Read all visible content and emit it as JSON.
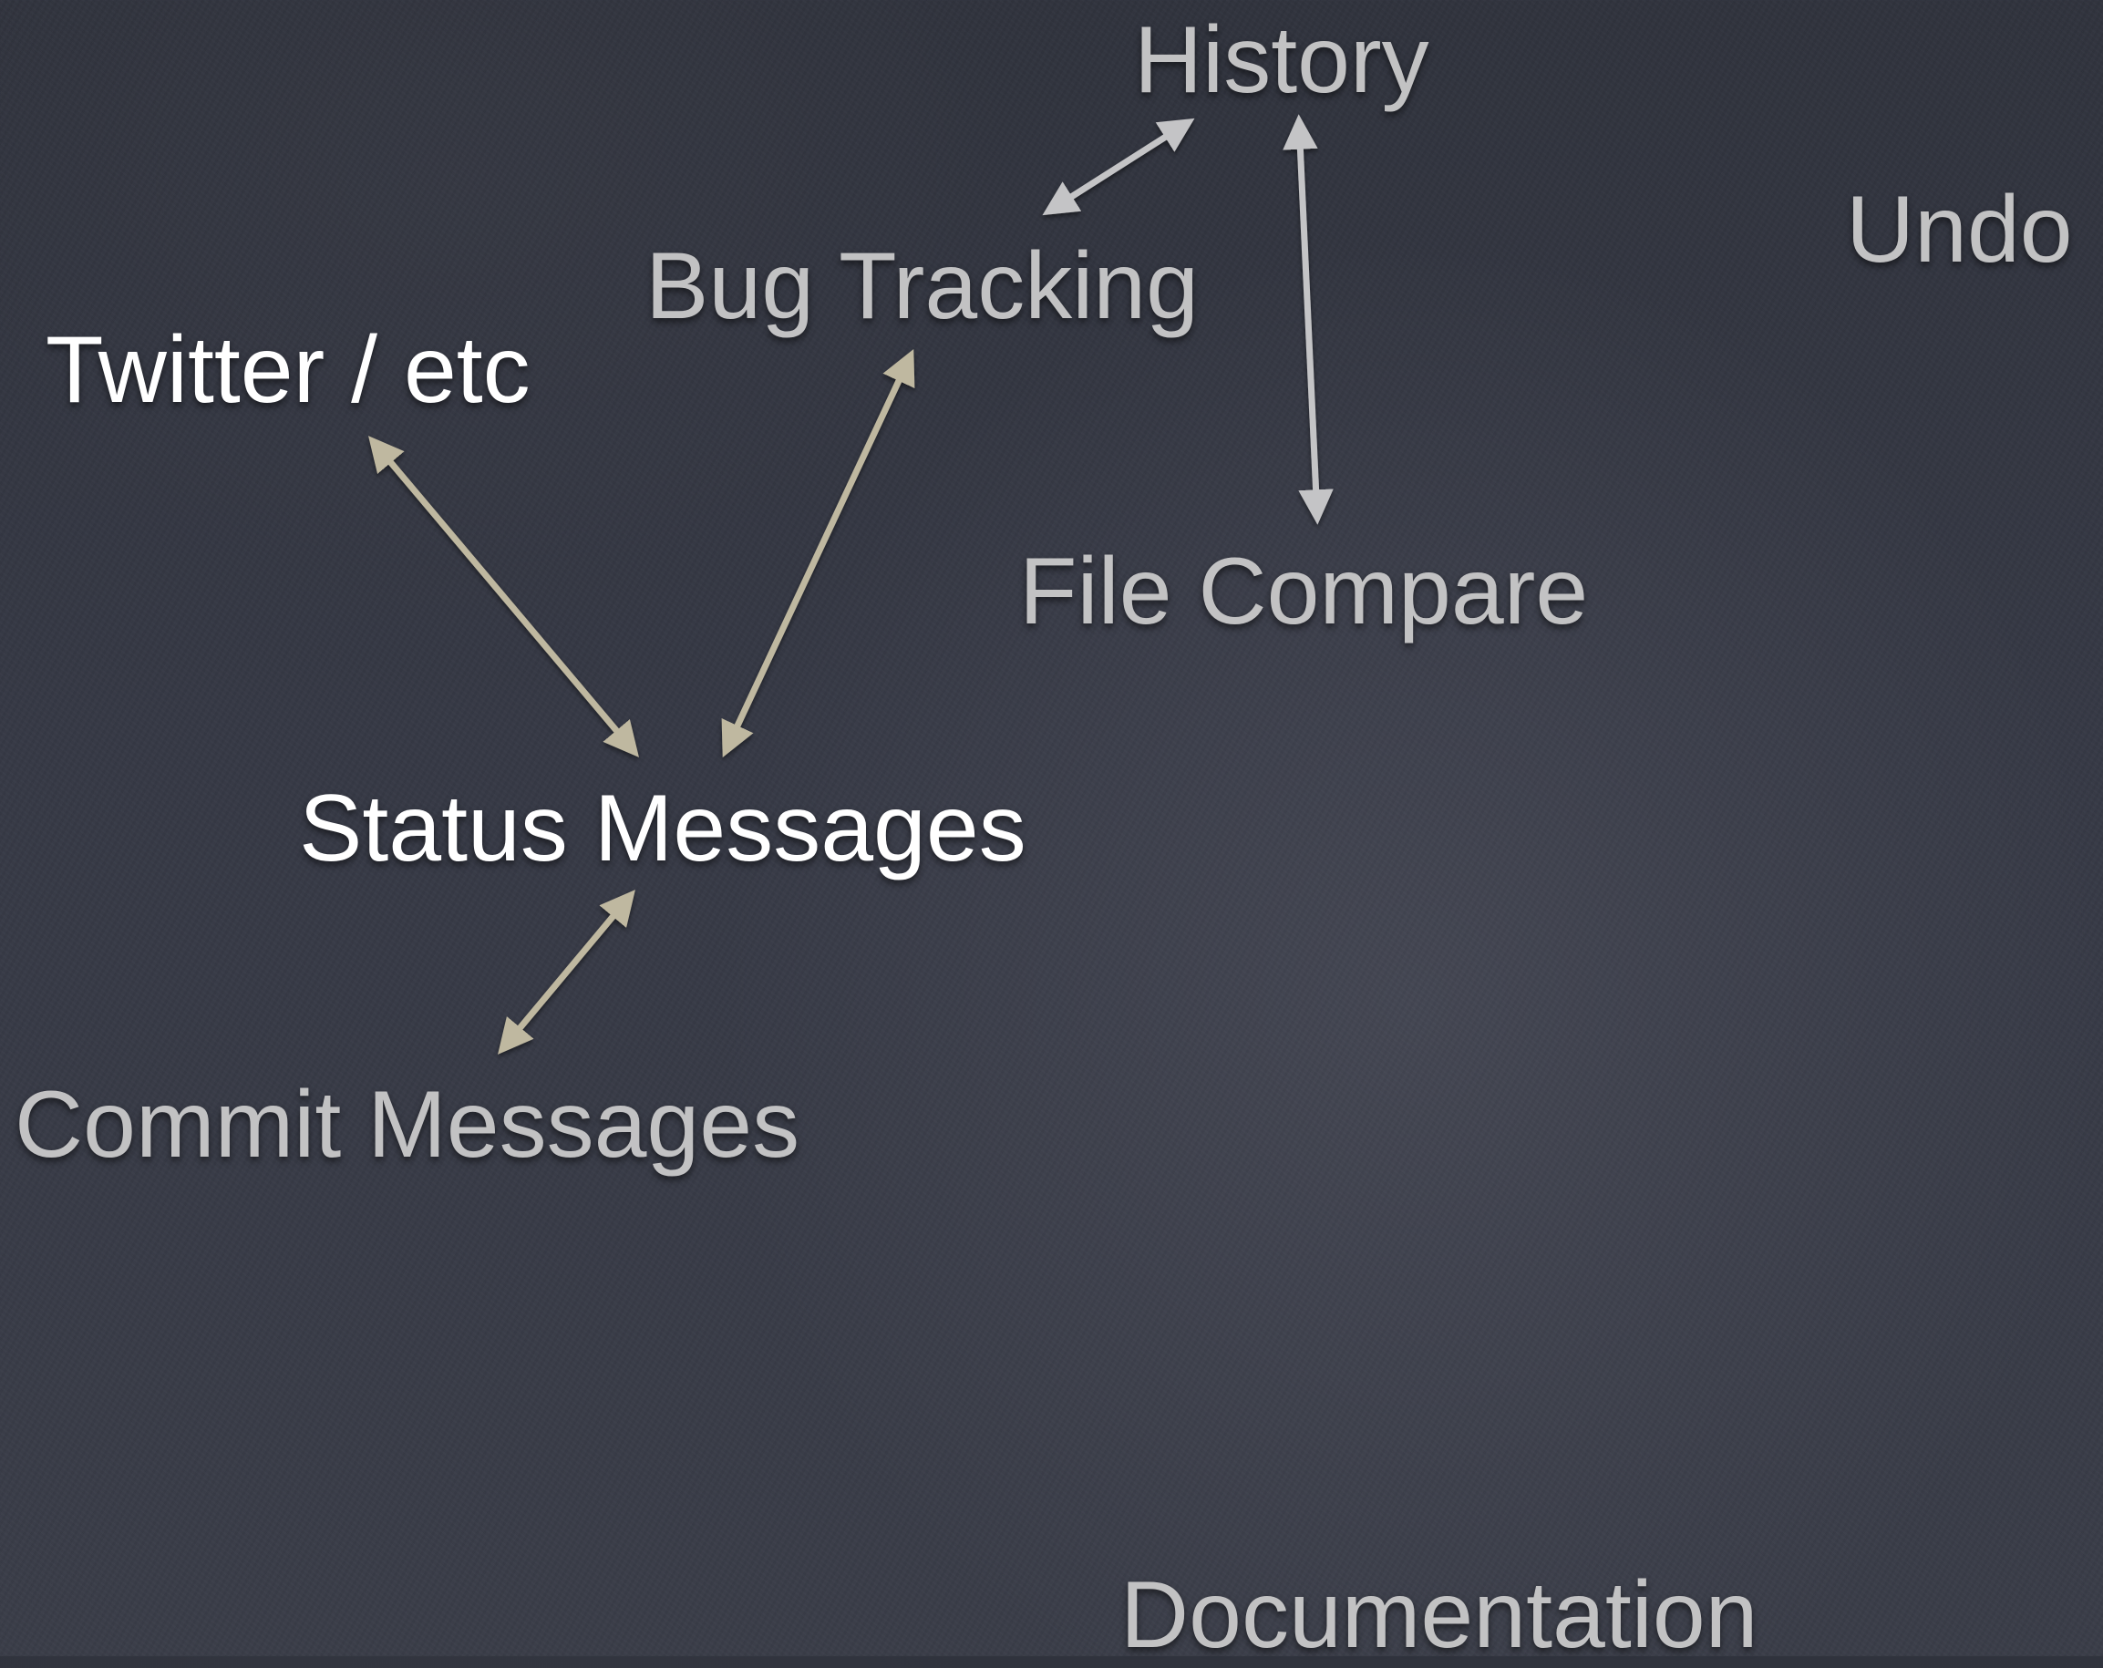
{
  "slide": {
    "nodes": {
      "history": "History",
      "undo": "Undo",
      "bug_tracking": "Bug Tracking",
      "twitter": "Twitter / etc",
      "file_compare": "File Compare",
      "status_messages": "Status Messages",
      "commit_messages": "Commit Messages",
      "documentation": "Documentation"
    },
    "connections": [
      {
        "from": "Bug Tracking",
        "to": "History",
        "style": "gray"
      },
      {
        "from": "History",
        "to": "File Compare",
        "style": "gray"
      },
      {
        "from": "Twitter / etc",
        "to": "Status Messages",
        "style": "tan"
      },
      {
        "from": "Bug Tracking",
        "to": "Status Messages",
        "style": "tan"
      },
      {
        "from": "Status Messages",
        "to": "Commit Messages",
        "style": "tan"
      }
    ],
    "colors": {
      "background": "#353844",
      "gray_text": "#c2c2c3",
      "white_text": "#ffffff",
      "gray_arrow": "#c4c4c6",
      "tan_arrow": "#bfb8a0"
    }
  }
}
